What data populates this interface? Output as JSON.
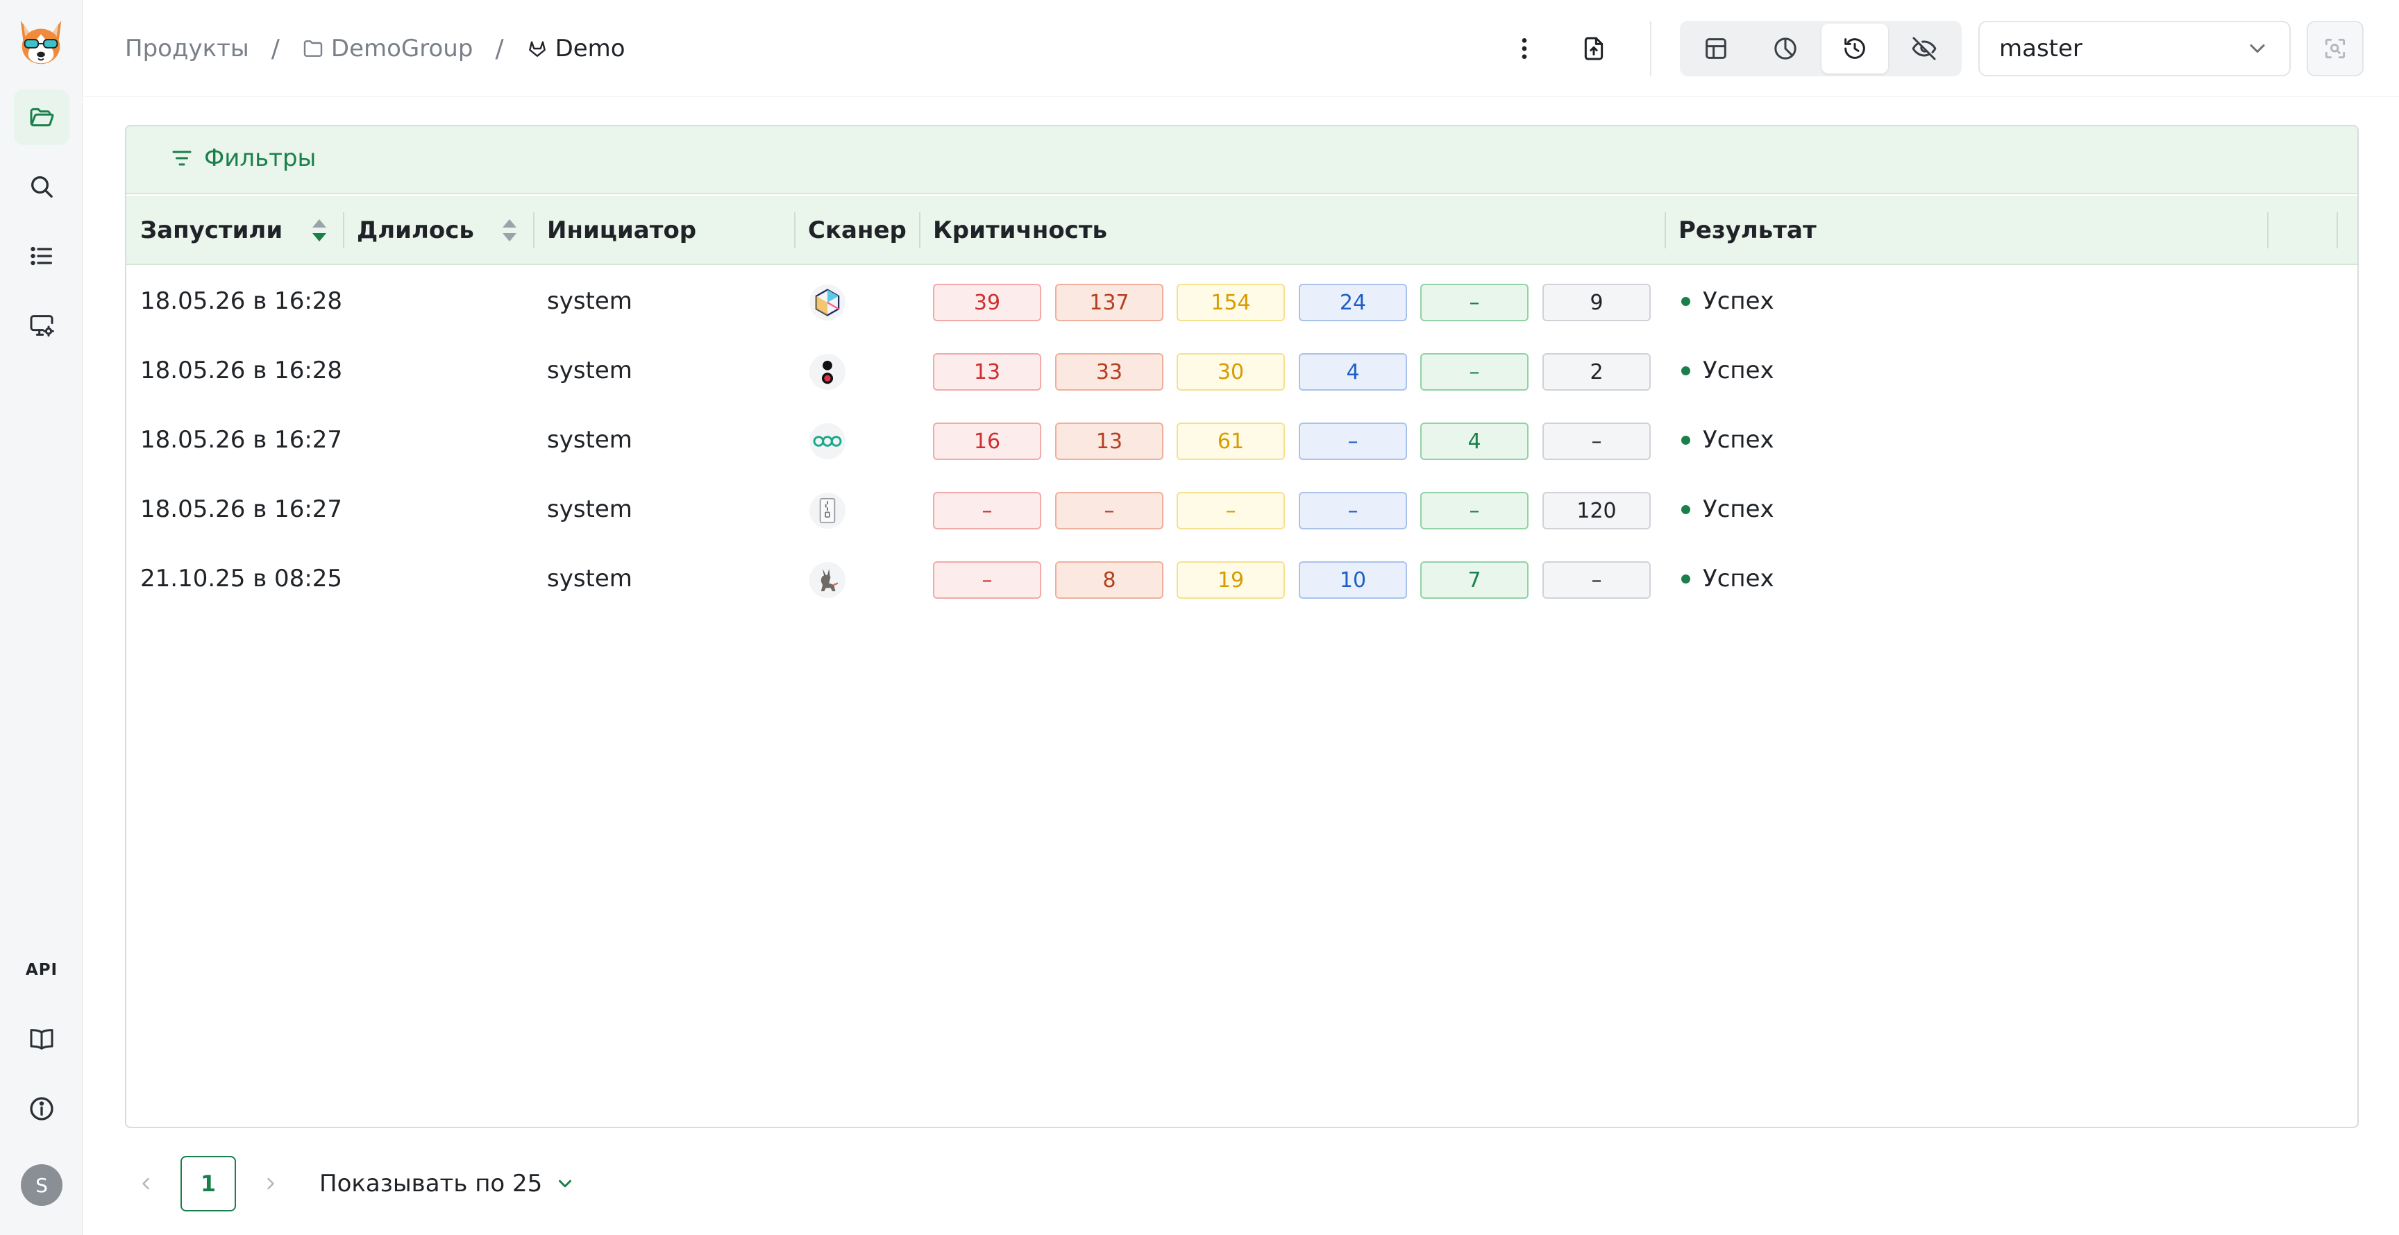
{
  "sidebar": {
    "logo": "corgi-logo",
    "items": [
      {
        "icon": "folder-open-icon",
        "active": true
      },
      {
        "icon": "search-icon",
        "active": false
      },
      {
        "icon": "list-icon",
        "active": false
      },
      {
        "icon": "monitor-settings-icon",
        "active": false
      }
    ],
    "bottom": {
      "api_label": "API",
      "docs_icon": "book-icon",
      "info_icon": "info-icon",
      "avatar": "S"
    }
  },
  "header": {
    "breadcrumbs": [
      {
        "label": "Продукты"
      },
      {
        "label": "DemoGroup",
        "icon": "folder-icon"
      },
      {
        "label": "Demo",
        "icon": "gitlab-icon"
      }
    ],
    "branch": "master",
    "actions": [
      "more-vertical-icon",
      "file-upload-icon"
    ],
    "views": [
      {
        "icon": "table-icon",
        "active": false
      },
      {
        "icon": "pie-chart-icon",
        "active": false
      },
      {
        "icon": "history-icon",
        "active": true
      },
      {
        "icon": "eye-off-icon",
        "active": false
      }
    ]
  },
  "filters_label": "Фильтры",
  "table": {
    "columns": {
      "started": "Запустили",
      "duration": "Длилось",
      "initiator": "Инициатор",
      "scanner": "Сканер",
      "severity": "Критичность",
      "result": "Результат"
    },
    "rows": [
      {
        "started": "18.05.26 в 16:28",
        "duration": "",
        "initiator": "system",
        "scanner": "trivy-cube-icon",
        "severity": [
          "39",
          "137",
          "154",
          "24",
          "–",
          "9"
        ],
        "result": "Успех"
      },
      {
        "started": "18.05.26 в 16:28",
        "duration": "",
        "initiator": "system",
        "scanner": "traffic-light-icon",
        "severity": [
          "13",
          "33",
          "30",
          "4",
          "–",
          "2"
        ],
        "result": "Успех"
      },
      {
        "started": "18.05.26 в 16:27",
        "duration": "",
        "initiator": "system",
        "scanner": "three-rings-icon",
        "severity": [
          "16",
          "13",
          "61",
          "–",
          "4",
          "–"
        ],
        "result": "Успех"
      },
      {
        "started": "18.05.26 в 16:27",
        "duration": "",
        "initiator": "system",
        "scanner": "zip-file-icon",
        "severity": [
          "–",
          "–",
          "–",
          "–",
          "–",
          "120"
        ],
        "result": "Успех"
      },
      {
        "started": "21.10.25 в 08:25",
        "duration": "",
        "initiator": "system",
        "scanner": "goat-icon",
        "severity": [
          "–",
          "8",
          "19",
          "10",
          "7",
          "–"
        ],
        "result": "Успех"
      }
    ]
  },
  "pagination": {
    "current_page": "1",
    "per_page_label": "Показывать по",
    "per_page": "25"
  },
  "colors": {
    "accent": "#1a7f4b",
    "header_bg": "#eaf5ec"
  }
}
